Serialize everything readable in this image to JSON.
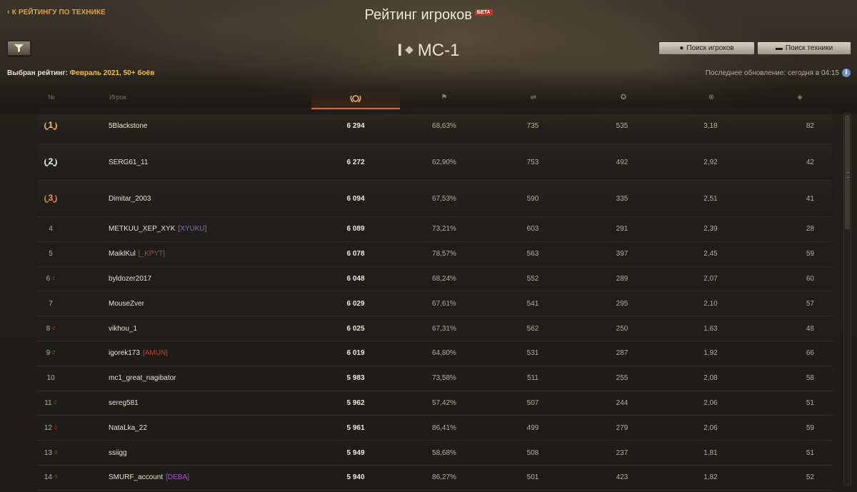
{
  "header": {
    "back_label": "К РЕЙТИНГУ ПО ТЕХНИКЕ",
    "title": "Рейтинг игроков",
    "beta_badge": "БЕТА",
    "vehicle_tier": "I",
    "vehicle_name": "МС-1",
    "rating_prefix": "Выбран рейтинг:",
    "rating_value": "Февраль 2021, 50+ боёв",
    "search_players_label": "Поиск игроков",
    "search_vehicles_label": "Поиск техники",
    "last_update": "Последнее обновление: сегодня в 04:15"
  },
  "table": {
    "columns": {
      "rank": "№",
      "player": "Игрок"
    },
    "rows": [
      {
        "rank": "1",
        "medal": "gold",
        "name": "5Blackstone",
        "clan": "",
        "clan_color": "",
        "rating": "6 294",
        "win": "68,63%",
        "battles": "735",
        "avg": "535",
        "ratio": "3,18",
        "last": "82",
        "change": ""
      },
      {
        "rank": "2",
        "medal": "silver",
        "name": "SERG61_11",
        "clan": "",
        "clan_color": "",
        "rating": "6 272",
        "win": "62,90%",
        "battles": "753",
        "avg": "492",
        "ratio": "2,92",
        "last": "42",
        "change": ""
      },
      {
        "rank": "3",
        "medal": "bronze",
        "name": "Dimitar_2003",
        "clan": "",
        "clan_color": "",
        "rating": "6 094",
        "win": "67,53%",
        "battles": "590",
        "avg": "335",
        "ratio": "2,51",
        "last": "41",
        "change": ""
      },
      {
        "rank": "4",
        "medal": "",
        "name": "METKUU_XEP_XYK",
        "clan": "[XYUKU]",
        "clan_color": "#8c6e9c",
        "rating": "6 089",
        "win": "73,21%",
        "battles": "603",
        "avg": "291",
        "ratio": "2,39",
        "last": "28",
        "change": ""
      },
      {
        "rank": "5",
        "medal": "",
        "name": "MaiklKul",
        "clan": "[_KPYT]",
        "clan_color": "#a0553f",
        "rating": "6 078",
        "win": "78,57%",
        "battles": "563",
        "avg": "397",
        "ratio": "2,45",
        "last": "59",
        "change": ""
      },
      {
        "rank": "6",
        "medal": "",
        "name": "byldozer2017",
        "clan": "",
        "clan_color": "",
        "rating": "6 048",
        "win": "68,24%",
        "battles": "552",
        "avg": "289",
        "ratio": "2,07",
        "last": "60",
        "change": "-1"
      },
      {
        "rank": "7",
        "medal": "",
        "name": "MouseZver",
        "clan": "",
        "clan_color": "",
        "rating": "6 029",
        "win": "67,61%",
        "battles": "541",
        "avg": "295",
        "ratio": "2,10",
        "last": "57",
        "change": ""
      },
      {
        "rank": "8",
        "medal": "",
        "name": "vikhou_1",
        "clan": "",
        "clan_color": "",
        "rating": "6 025",
        "win": "67,31%",
        "battles": "562",
        "avg": "250",
        "ratio": "1,63",
        "last": "48",
        "change": "-2"
      },
      {
        "rank": "9",
        "medal": "",
        "name": "igorek173",
        "clan": "[AMUN]",
        "clan_color": "#b8452f",
        "rating": "6 019",
        "win": "64,80%",
        "battles": "531",
        "avg": "287",
        "ratio": "1,92",
        "last": "66",
        "change": "-2"
      },
      {
        "rank": "10",
        "medal": "",
        "name": "mc1_great_nagibator",
        "clan": "",
        "clan_color": "",
        "rating": "5 983",
        "win": "73,58%",
        "battles": "511",
        "avg": "255",
        "ratio": "2,08",
        "last": "58",
        "change": ""
      },
      {
        "rank": "11",
        "medal": "",
        "name": "sereg581",
        "clan": "",
        "clan_color": "",
        "rating": "5 962",
        "win": "57,42%",
        "battles": "507",
        "avg": "244",
        "ratio": "2,06",
        "last": "51",
        "change": "-2"
      },
      {
        "rank": "12",
        "medal": "",
        "name": "NataLka_22",
        "clan": "",
        "clan_color": "",
        "rating": "5 961",
        "win": "86,41%",
        "battles": "499",
        "avg": "279",
        "ratio": "2,06",
        "last": "59",
        "change": "-2"
      },
      {
        "rank": "13",
        "medal": "",
        "name": "ssiigg",
        "clan": "",
        "clan_color": "",
        "rating": "5 949",
        "win": "58,68%",
        "battles": "508",
        "avg": "237",
        "ratio": "1,81",
        "last": "51",
        "change": "-3"
      },
      {
        "rank": "14",
        "medal": "",
        "name": "SMURF_account",
        "clan": "[DEBA]",
        "clan_color": "#b04fd0",
        "rating": "5 940",
        "win": "86,27%",
        "battles": "501",
        "avg": "423",
        "ratio": "1,82",
        "last": "52",
        "change": "-3"
      }
    ]
  },
  "colors": {
    "accent": "#d66a1d",
    "link": "#e5a13a",
    "rating_value": "#f2c14a"
  }
}
